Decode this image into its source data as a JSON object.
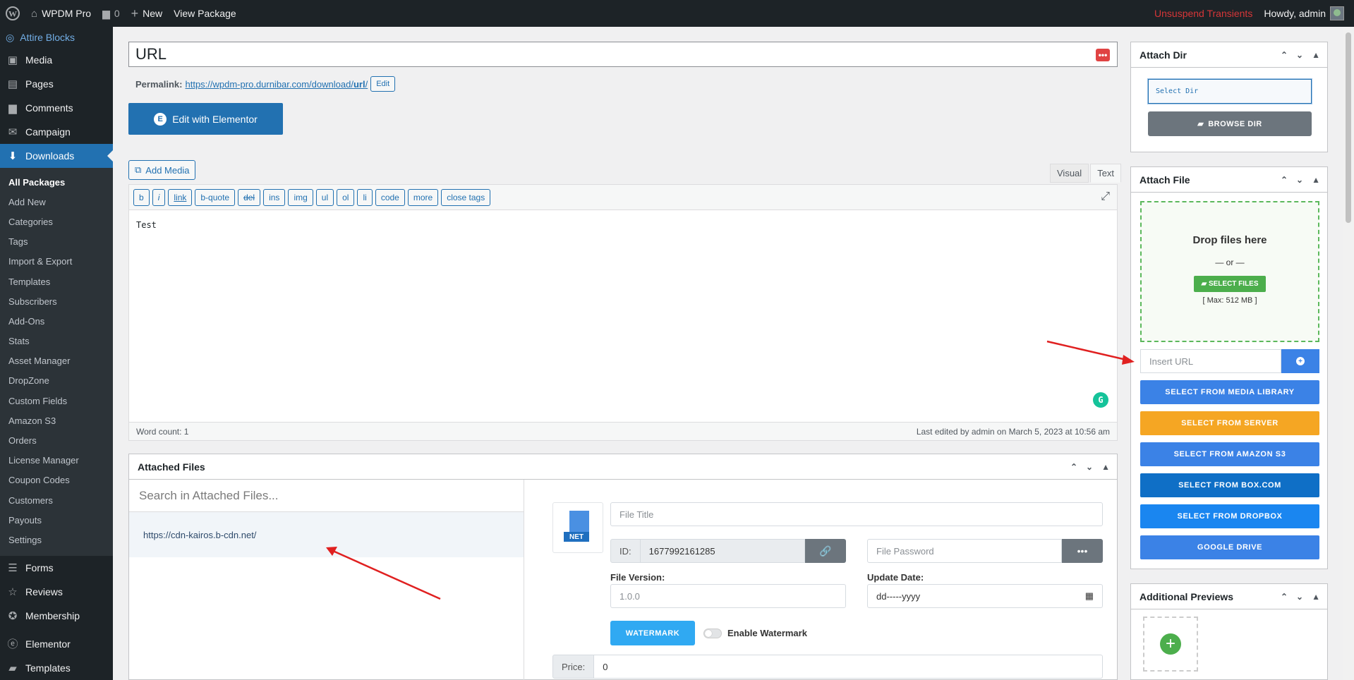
{
  "adminbar": {
    "site_name": "WPDM Pro",
    "comments_count": "0",
    "new_label": "New",
    "view_label": "View Package",
    "unsuspend": "Unsuspend Transients",
    "howdy": "Howdy, admin"
  },
  "sidebar": {
    "top_label": "Attire Blocks",
    "items_before": [
      {
        "label": "Media",
        "icon": "media-icon"
      },
      {
        "label": "Pages",
        "icon": "pages-icon"
      },
      {
        "label": "Comments",
        "icon": "comments-icon"
      },
      {
        "label": "Campaign",
        "icon": "mail-icon"
      }
    ],
    "active_item": {
      "label": "Downloads",
      "icon": "download-icon"
    },
    "submenu": [
      "All Packages",
      "Add New",
      "Categories",
      "Tags",
      "Import & Export",
      "Templates",
      "Subscribers",
      "Add-Ons",
      "Stats",
      "Asset Manager",
      "DropZone",
      "Custom Fields",
      "Amazon S3",
      "Orders",
      "License Manager",
      "Coupon Codes",
      "Customers",
      "Payouts",
      "Settings"
    ],
    "items_after": [
      {
        "label": "Forms",
        "icon": "forms-icon"
      },
      {
        "label": "Reviews",
        "icon": "star-icon"
      },
      {
        "label": "Membership",
        "icon": "membership-icon"
      }
    ],
    "items_after2": [
      {
        "label": "Elementor",
        "icon": "elementor-icon"
      },
      {
        "label": "Templates",
        "icon": "folder-icon"
      }
    ]
  },
  "editor": {
    "title": "URL",
    "permalink_label": "Permalink:",
    "permalink_base": "https://wpdm-pro.durnibar.com/download/",
    "permalink_slug": "url",
    "permalink_end": "/",
    "permalink_edit": "Edit",
    "elementor_btn": "Edit with Elementor",
    "add_media": "Add Media",
    "tab_visual": "Visual",
    "tab_text": "Text",
    "quicktags": [
      "b",
      "i",
      "link",
      "b-quote",
      "del",
      "ins",
      "img",
      "ul",
      "ol",
      "li",
      "code",
      "more",
      "close tags"
    ],
    "content": "Test",
    "word_count": "Word count: 1",
    "last_edited": "Last edited by admin on March 5, 2023 at 10:56 am"
  },
  "attached_files": {
    "title": "Attached Files",
    "search_placeholder": "Search in Attached Files...",
    "files": [
      "https://cdn-kairos.b-cdn.net/"
    ],
    "file_type": "NET",
    "file_title_placeholder": "File Title",
    "id_label": "ID:",
    "id_value": "1677992161285",
    "password_placeholder": "File Password",
    "version_label": "File Version:",
    "version_placeholder": "1.0.0",
    "update_label": "Update Date:",
    "update_placeholder": "dd-----yyyy",
    "watermark_btn": "WATERMARK",
    "enable_watermark": "Enable Watermark",
    "price_label": "Price:",
    "price_value": "0"
  },
  "attach_dir": {
    "title": "Attach Dir",
    "select_placeholder": "Select Dir",
    "browse_btn": "BROWSE DIR"
  },
  "attach_file": {
    "title": "Attach File",
    "drop_text": "Drop files here",
    "or_text": "— or —",
    "select_files": "SELECT FILES",
    "max_size": "[ Max: 512 MB ]",
    "insert_url_placeholder": "Insert URL",
    "buttons": [
      {
        "label": "SELECT FROM MEDIA LIBRARY",
        "color": "#3b82e6"
      },
      {
        "label": "SELECT FROM SERVER",
        "color": "#f5a623"
      },
      {
        "label": "SELECT FROM AMAZON S3",
        "color": "#3b82e6"
      },
      {
        "label": "SELECT FROM BOX.COM",
        "color": "#0f6fc6"
      },
      {
        "label": "SELECT FROM DROPBOX",
        "color": "#1a86f0"
      },
      {
        "label": "GOOGLE DRIVE",
        "color": "#3b82e6"
      }
    ]
  },
  "additional_previews": {
    "title": "Additional Previews"
  },
  "colors": {
    "admin_bg": "#1d2327",
    "accent": "#2271b1",
    "annotation_arrow": "#e02020"
  }
}
